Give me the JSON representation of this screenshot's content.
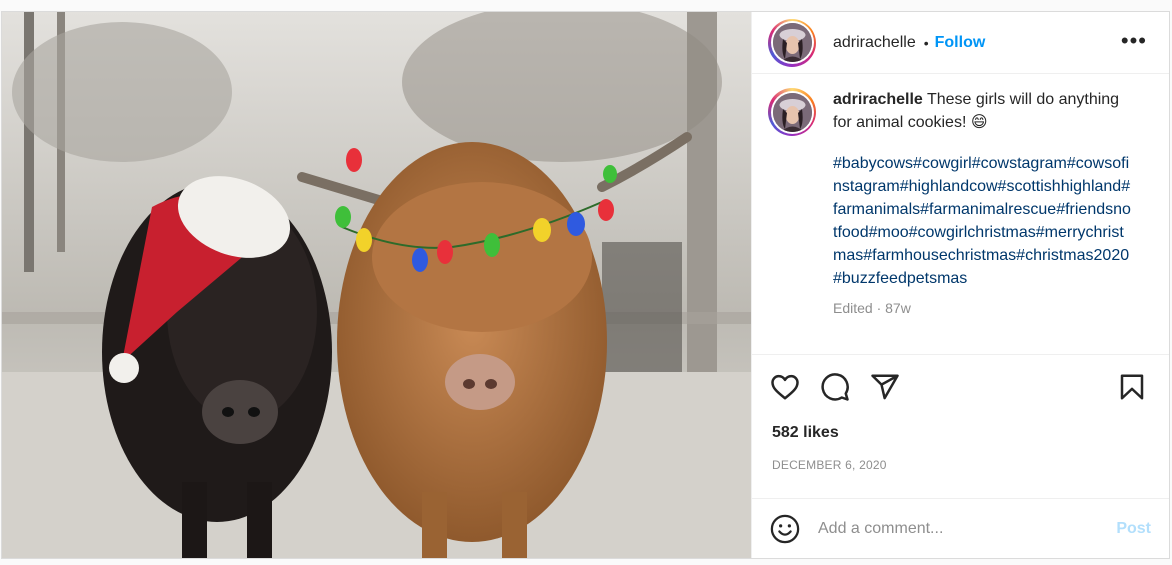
{
  "post": {
    "author": "adrirachelle",
    "follow_label": "Follow",
    "separator": "•",
    "more_label": "•••",
    "caption_text": "These girls will do anything for animal cookies! 😄",
    "hashtags": "#babycows#cowgirl#cowstagram#cowsofinstagram#highlandcow#scottishhighland#farmanimals#farmanimalrescue#friendsnotfood#moo#cowgirlchristmas#merrychristmas#farmhousechristmas#christmas2020#buzzfeedpetsmas",
    "edited_meta": "Edited · 87w",
    "likes": "582 likes",
    "date": "DECEMBER 6, 2020"
  },
  "comment_box": {
    "placeholder": "Add a comment...",
    "post_label": "Post"
  },
  "icons": {
    "like": "heart-icon",
    "comment": "comment-icon",
    "share": "share-icon",
    "save": "bookmark-icon",
    "emoji": "emoji-icon",
    "more": "more-options-icon"
  },
  "colors": {
    "follow_blue": "#0095f6",
    "hashtag": "#00376b",
    "post_disabled": "#b2dffc",
    "meta_gray": "#8e8e8e"
  }
}
